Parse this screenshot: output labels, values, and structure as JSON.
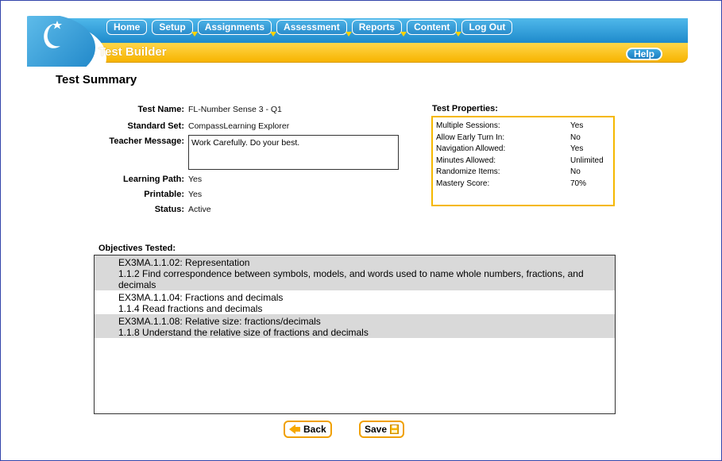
{
  "nav": {
    "items": [
      "Home",
      "Setup",
      "Assignments",
      "Assessment",
      "Reports",
      "Content",
      "Log Out"
    ]
  },
  "header": {
    "page_title": "Test Builder",
    "help_label": "Help"
  },
  "summary": {
    "heading": "Test Summary",
    "test_name_label": "Test Name:",
    "test_name": "FL-Number Sense 3 - Q1",
    "standard_set_label": "Standard Set:",
    "standard_set": "CompassLearning Explorer",
    "teacher_message_label": "Teacher Message:",
    "teacher_message": "Work Carefully. Do your best.",
    "learning_path_label": "Learning Path:",
    "learning_path": "Yes",
    "printable_label": "Printable:",
    "printable": "Yes",
    "status_label": "Status:",
    "status": "Active"
  },
  "properties": {
    "title": "Test Properties:",
    "rows": [
      {
        "label": "Multiple Sessions:",
        "value": "Yes"
      },
      {
        "label": "Allow Early Turn In:",
        "value": "No"
      },
      {
        "label": "Navigation Allowed:",
        "value": "Yes"
      },
      {
        "label": "Minutes Allowed:",
        "value": "Unlimited"
      },
      {
        "label": "Randomize Items:",
        "value": "No"
      },
      {
        "label": "Mastery Score:",
        "value": "70%"
      }
    ]
  },
  "objectives": {
    "title": "Objectives Tested:",
    "items": [
      {
        "code": "EX3MA.1.1.02: Representation",
        "desc": "1.1.2 Find correspondence between symbols, models, and words used to name whole numbers, fractions, and decimals"
      },
      {
        "code": "EX3MA.1.1.04: Fractions and decimals",
        "desc": "1.1.4 Read fractions and decimals"
      },
      {
        "code": "EX3MA.1.1.08: Relative size: fractions/decimals",
        "desc": "1.1.8 Understand the relative size of fractions and decimals"
      }
    ]
  },
  "buttons": {
    "back": "Back",
    "save": "Save"
  },
  "colors": {
    "nav_blue": "#1a86c9",
    "accent_orange": "#f7b400",
    "row_shade": "#d9d9d9"
  }
}
